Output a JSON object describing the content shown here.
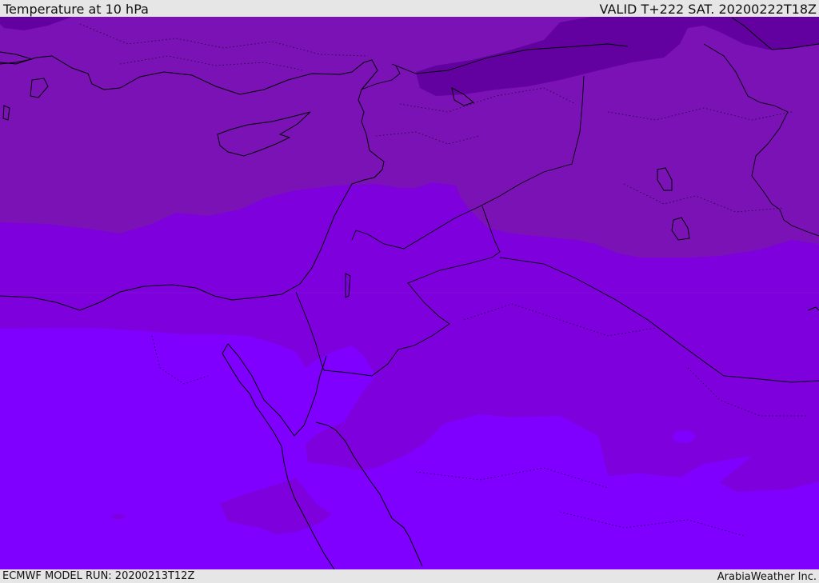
{
  "header": {
    "title": "Temperature at 10 hPa",
    "valid_time": "VALID T+222 SAT. 20200222T18Z"
  },
  "footer": {
    "model_run": "ECMWF MODEL RUN: 20200213T12Z",
    "credit": "ArabiaWeather Inc."
  },
  "map": {
    "region": "Eastern Mediterranean and Middle East",
    "colors": {
      "band_darkest": "#6200a0",
      "band_dark": "#7a12b6",
      "band_mid": "#7e00dc",
      "band_light": "#7f00ff",
      "coastline": "#000000"
    }
  }
}
